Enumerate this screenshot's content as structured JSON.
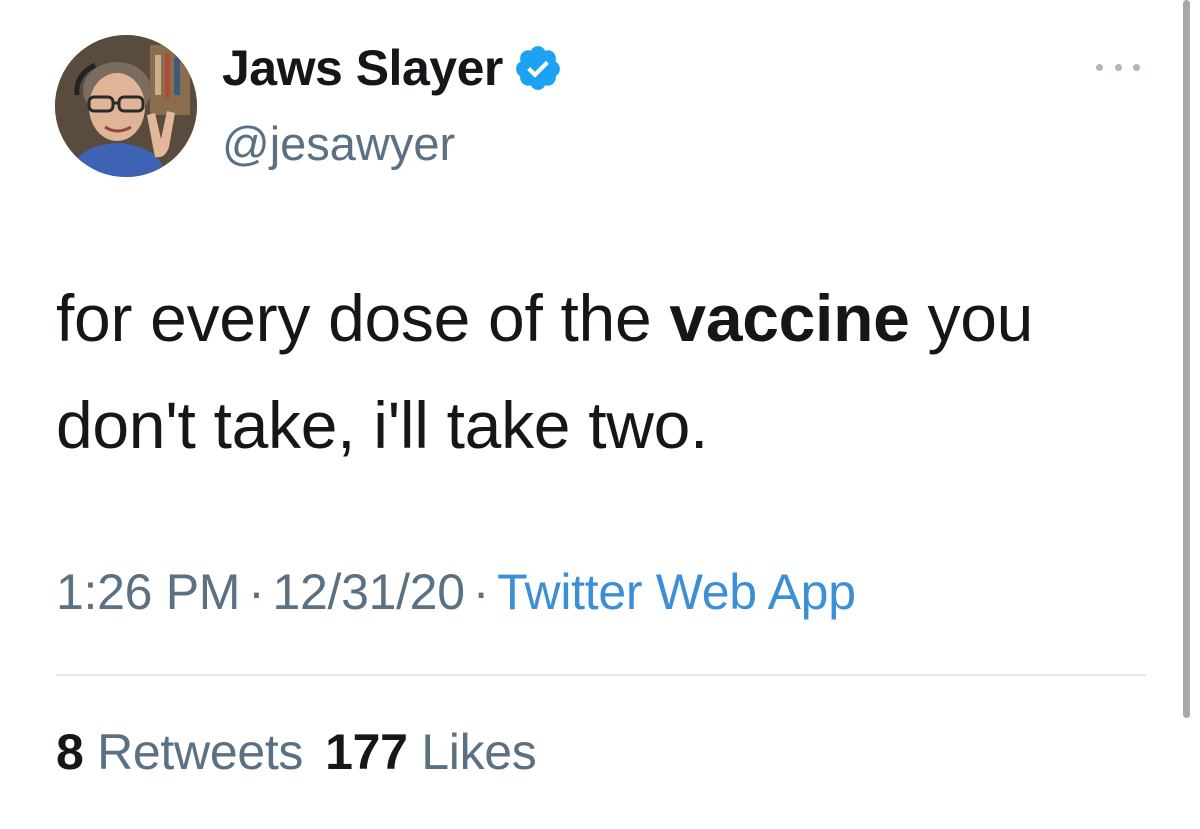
{
  "tweet": {
    "display_name": "Jaws Slayer",
    "verified_icon": "verified-badge-icon",
    "handle": "@jesawyer",
    "text": {
      "part1": "for every dose of the ",
      "bold": "vaccine",
      "part2": " you don't take, i'll take two."
    },
    "time": "1:26 PM",
    "date": "12/31/20",
    "separator": "·",
    "source": "Twitter Web App",
    "retweets_count": "8",
    "retweets_label": "Retweets",
    "likes_count": "177",
    "likes_label": "Likes"
  },
  "colors": {
    "text_primary": "#14171a",
    "text_secondary": "#5b7083",
    "link": "#3b8fd6",
    "verified": "#1da1f2"
  },
  "icons": {
    "more": "more-horizontal-icon",
    "avatar": "avatar"
  }
}
